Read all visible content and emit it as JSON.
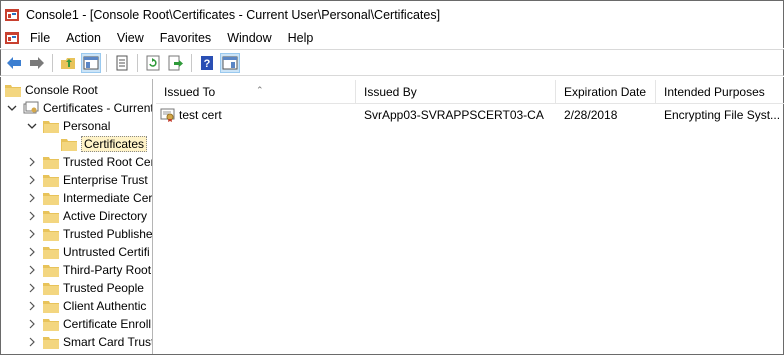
{
  "window": {
    "title": "Console1 - [Console Root\\Certificates - Current User\\Personal\\Certificates]"
  },
  "menu": [
    "File",
    "Action",
    "View",
    "Favorites",
    "Window",
    "Help"
  ],
  "toolbar": {
    "buttons": [
      "back-icon",
      "forward-icon",
      "up-folder-icon",
      "show-hide-tree-icon",
      "properties-icon",
      "refresh-icon",
      "export-icon",
      "help-icon",
      "show-hide-action-pane-icon"
    ]
  },
  "tree": {
    "root": "Console Root",
    "certificates": "Certificates - Current",
    "personal": "Personal",
    "selected": "Certificates",
    "children": [
      "Trusted Root Cer",
      "Enterprise Trust",
      "Intermediate Cer",
      "Active Directory",
      "Trusted Publishe",
      "Untrusted Certifi",
      "Third-Party Root",
      "Trusted People",
      "Client Authentic",
      "Certificate Enroll",
      "Smart Card Trust"
    ]
  },
  "list": {
    "columns": [
      "Issued To",
      "Issued By",
      "Expiration Date",
      "Intended Purposes"
    ],
    "rows": [
      {
        "issued_to": "test cert",
        "issued_by": "SvrApp03-SVRAPPSCERT03-CA",
        "expiration": "2/28/2018",
        "purposes": "Encrypting File Syst..."
      }
    ]
  },
  "colors": {
    "selection": "#fff3c8",
    "pressed": "#cce4f7",
    "folder": "#e8c35a"
  }
}
